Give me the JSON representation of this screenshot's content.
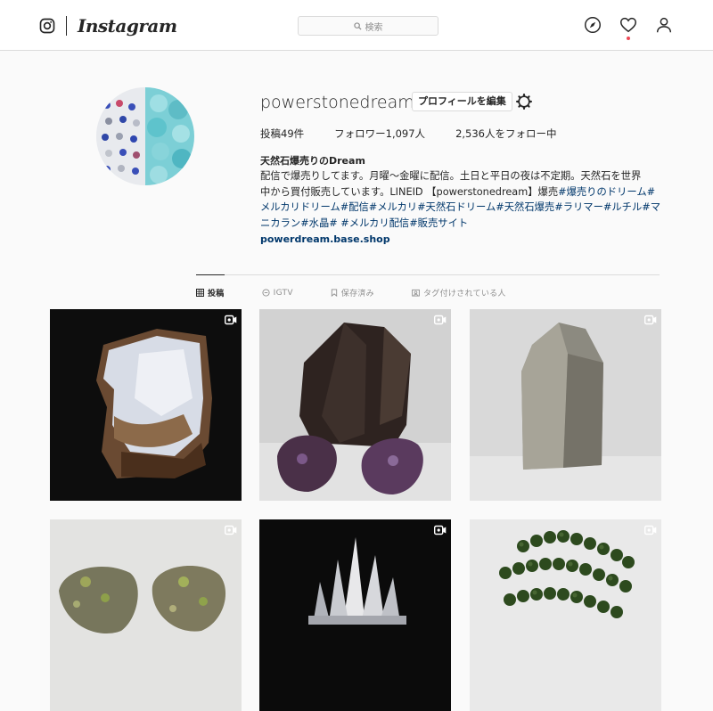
{
  "nav": {
    "logo_text": "Instagram",
    "search_placeholder": "検索",
    "icons": [
      "instagram-glyph-icon",
      "search-icon",
      "compass-icon",
      "heart-icon",
      "profile-icon"
    ]
  },
  "profile": {
    "username": "powerstonedream",
    "edit_button": "プロフィールを編集",
    "stats": {
      "posts": "投稿49件",
      "followers": "フォロワー1,097人",
      "following": "2,536人をフォロー中"
    },
    "full_name": "天然石爆売りのDream",
    "bio_line1": "配信で爆売りしてます。月曜〜金曜に配信。土日と平日の夜は不定期。天然石を世界",
    "bio_line2_text": "中から買付販売しています。LINEID 【powerstonedream】爆売",
    "bio_line2_tag": "#爆売りのドリーム#",
    "bio_line3": "メルカリドリーム#配信#メルカリ#天然石ドリーム#天然石爆売#ラリマー#ルチル#マ",
    "bio_line4": "ニカラン#水晶# #メルカリ配信#販売サイト",
    "website": "powerdream.base.shop"
  },
  "tabs": [
    {
      "label": "投稿",
      "icon": "grid-icon",
      "active": true
    },
    {
      "label": "IGTV",
      "icon": "igtv-icon",
      "active": false
    },
    {
      "label": "保存済み",
      "icon": "bookmark-icon",
      "active": false
    },
    {
      "label": "タグ付けされている人",
      "icon": "tagged-icon",
      "active": false
    }
  ],
  "posts": [
    {
      "subject": "opal slab",
      "badge": "video-icon"
    },
    {
      "subject": "smoky quartz with amethyst",
      "badge": "video-icon"
    },
    {
      "subject": "rutilated quartz point",
      "badge": "video-icon"
    },
    {
      "subject": "green crystal rocks",
      "badge": "video-icon"
    },
    {
      "subject": "clear quartz cluster",
      "badge": "video-icon"
    },
    {
      "subject": "green bead bracelets",
      "badge": "video-icon"
    }
  ],
  "colors": {
    "link": "#00376b",
    "border": "#dbdbdb",
    "notification": "#ed4956",
    "background": "#fafafa"
  }
}
